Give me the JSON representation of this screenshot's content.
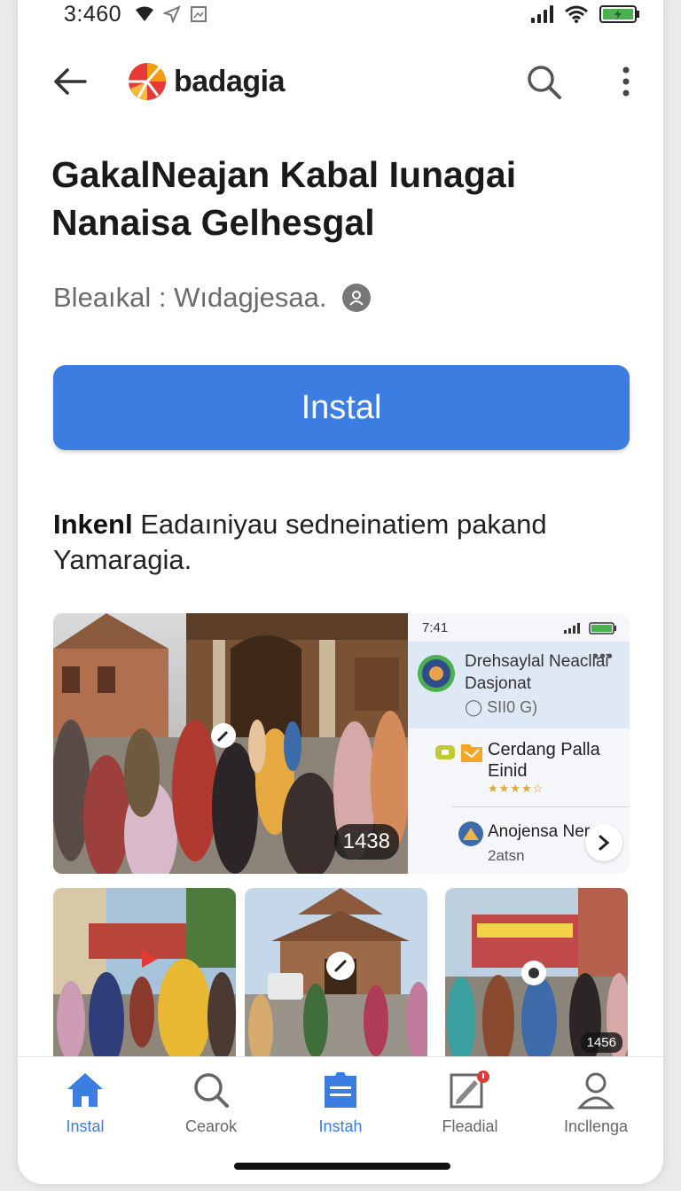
{
  "status_bar": {
    "time": "3:460",
    "battery_color": "#4caf50"
  },
  "app_bar": {
    "logo_text": "badagia",
    "icons": [
      "back-arrow-icon",
      "logo-icon",
      "search-icon",
      "more-vertical-icon"
    ]
  },
  "app": {
    "title": "GakalNeajan Kabal Iunagai Nanaisa Gelhesgal",
    "developer": "Bleaıkal : Wıdagjesaa.",
    "install_label": "Instal",
    "description_bold": "Inkenl",
    "description_rest": " Eadaıniyau sedneinatiem pakand Yamaragia."
  },
  "screenshots": {
    "large_badge": "1438",
    "phone": {
      "time": "7:41",
      "card1_title": "Drehsaylal Neacliai Dasjonat",
      "card1_sub": "◯ SII0 G)",
      "card1_more": "•••",
      "card2_title": "Cerdang Palla Einid",
      "card2_rating": 4,
      "card3_title": "Anojensa Ner",
      "card3_sub": "2atsn"
    },
    "small3_badge": "1456"
  },
  "bottom_nav": {
    "items": [
      {
        "label": "Instal",
        "icon": "home-icon",
        "active": true
      },
      {
        "label": "Cearok",
        "icon": "search-icon",
        "active": false
      },
      {
        "label": "Instah",
        "icon": "document-icon",
        "active": true
      },
      {
        "label": "Fleadial",
        "icon": "edit-icon",
        "active": false
      },
      {
        "label": "Incllenga",
        "icon": "person-icon",
        "active": false
      }
    ]
  },
  "colors": {
    "accent": "#3b7de0",
    "logo_red": "#e53935",
    "logo_orange": "#f39c12"
  }
}
